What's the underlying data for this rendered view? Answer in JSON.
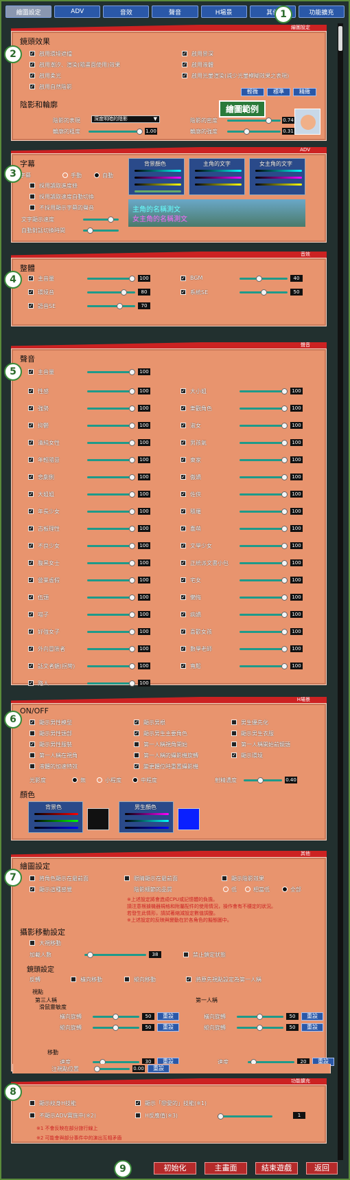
{
  "tabs": [
    "繪圖設定",
    "ADV",
    "音效",
    "聲音",
    "H場景",
    "其他",
    "功能擴充"
  ],
  "sections": {
    "draw": "繪圖設定",
    "adv": "ADV",
    "sound": "音效",
    "voice": "聲音",
    "h": "H場景",
    "other": "其他",
    "ext": "功能擴充"
  },
  "markers": [
    "1",
    "2",
    "3",
    "4",
    "5",
    "6",
    "7",
    "8",
    "9"
  ],
  "lens": {
    "title": "鏡頭效果",
    "items": [
      "啟用環境遮擋",
      "啟用景深",
      "啟用潮汐、渲染(隨畫面使用)效果",
      "啟用柔光",
      "啟用液體",
      "啟用光暈渲染(減少光暈模糊效果之表現)",
      "啟用自然陰影"
    ],
    "buttons": [
      "輕微",
      "標準",
      "精緻"
    ]
  },
  "shadow": {
    "title": "陰影和輪廓",
    "type_label": "陰影的表現",
    "type_value": "深度明暗的陰影",
    "wt_label": "輪廓的粗度",
    "wt_value": "1.00",
    "dense_label": "陰影的密度",
    "dense_value": "0.74",
    "line_label": "輪廓的強度",
    "line_value": "0.31",
    "sample": "繪圖範例"
  },
  "caption": {
    "title": "字幕",
    "mode_label": "字幕",
    "opts": [
      "手動",
      "自動"
    ],
    "items": [
      "採用讀取進度條",
      "採用讀取速度自動切換",
      "不採用顯示字幕的聲音"
    ],
    "speed_label": "文字顯示速度",
    "auto_label": "自動對話切換時間",
    "boxes": [
      "背景顏色",
      "主角的文字",
      "女主角的文字"
    ],
    "sample1": "主角的名稱測文",
    "sample2": "女主角的名稱測文"
  },
  "sfx": {
    "title": "整體",
    "rows": [
      [
        "主音量",
        "100"
      ],
      [
        "BGM",
        "40"
      ],
      [
        "環境音",
        "80"
      ],
      [
        "系統SE",
        "50"
      ],
      [
        "語音SE",
        "70"
      ]
    ]
  },
  "voice": {
    "title": "聲音",
    "master": [
      "主音量",
      "100"
    ],
    "rows": [
      [
        "性感",
        "100"
      ],
      [
        "大小姐",
        "100"
      ],
      [
        "強勢",
        "100"
      ],
      [
        "樂觀角色",
        "100"
      ],
      [
        "抑鬱",
        "100"
      ],
      [
        "淑女",
        "100"
      ],
      [
        "清純女性",
        "100"
      ],
      [
        "男孩氣",
        "100"
      ],
      [
        "年輕隨意",
        "100"
      ],
      [
        "東家",
        "100"
      ],
      [
        "悲劇側",
        "100"
      ],
      [
        "傲嬌",
        "100"
      ],
      [
        "大姐姐",
        "100"
      ],
      [
        "佐俠",
        "100"
      ],
      [
        "年長少女",
        "100"
      ],
      [
        "積羅",
        "100"
      ],
      [
        "古板理性",
        "100"
      ],
      [
        "蠢萌",
        "100"
      ],
      [
        "不良少女",
        "100"
      ],
      [
        "文學少女",
        "100"
      ],
      [
        "腹黑女士",
        "100"
      ],
      [
        "正統派文書小包",
        "100"
      ],
      [
        "營業虛假",
        "100"
      ],
      [
        "宅女",
        "100"
      ],
      [
        "伍頭",
        "100"
      ],
      [
        "懶悔",
        "100"
      ],
      [
        "喵子",
        "100"
      ],
      [
        "病嬌",
        "100"
      ],
      [
        "好強女子",
        "100"
      ],
      [
        "喜歡女孩",
        "100"
      ],
      [
        "外向冒險者",
        "100"
      ],
      [
        "數學老師",
        "100"
      ],
      [
        "話文者靚(拐彎)",
        "100"
      ],
      [
        "寬鬆",
        "100"
      ],
      [
        "路人",
        "100"
      ]
    ]
  },
  "honoff": {
    "title": "ON/OFF",
    "items": [
      "顯示男性模型",
      "顯示男根",
      "男生優先化",
      "顯示男性頭部",
      "顯示男生主要角色",
      "顯示男生衣服",
      "顯示男性服裝",
      "第一人稱視角開始",
      "第一人稱開始前鏡頭",
      "第一人稱在視角",
      "第一人稱的攝影機旋轉",
      "顯示環境",
      "液體的加速特效",
      "變更體位時重置攝影機"
    ],
    "tone_label": "光影度",
    "tone_opts": [
      "無",
      "小程度",
      "中程度"
    ],
    "depth_label": "射精濃度",
    "depth_value": "0.40",
    "color_title": "顏色",
    "bg_label": "背景色",
    "male_label": "男生顏色"
  },
  "other": {
    "title": "繪圖設定",
    "items": [
      "將角色顯示在最前面",
      "眼睛顯示在最前面",
      "顯示陰影效果",
      "顯示這種感覺",
      "陰影細節的品質"
    ],
    "q_opts": [
      "低",
      "相當低",
      "全部"
    ],
    "notes": [
      "※上述設定將會造成CPU或記憶體的負擔。",
      "請注意根據機器規格和附屬配件的使用情況，操作會有不穩定的狀況。",
      "若發生此情形，請試著縮減設定數值調整。",
      "※上述設定的反映與變動在於各角色的擬態圖中。"
    ],
    "move_title": "攝影移動設定",
    "move_items": [
      "大視移動",
      "禁止鎖定狀態"
    ],
    "count_label": "加載人數",
    "count_value": "38",
    "lens_title": "鏡頭設定",
    "invert_label": "反轉",
    "inv_items": [
      "橫向移動",
      "縱向移動",
      "將原先視點設定為第一人稱"
    ],
    "third": "第三人稱",
    "first": "第一人稱",
    "view": "視點",
    "sens": "滑鼠靈敏度",
    "h_rot": "橫向旋轉",
    "v_rot": "縱向旋轉",
    "move": "移動",
    "speed": "速度",
    "zoom": "注視點位置",
    "v50": "50",
    "v30": "30",
    "v20": "20",
    "v000": "0.00",
    "reset": "重設"
  },
  "ext": {
    "items": [
      "顯示紋身H技能",
      "顯示「戀愛的」技能(※1)",
      "不顯示ADV實施中(※2)",
      "H反應值(※3)"
    ],
    "value": "1",
    "notes": [
      "※1  不會反映在部分旅行線上",
      "※2  可能會與部分事件中的演出互相矛盾"
    ]
  },
  "footer": {
    "buttons": [
      "初始化",
      "主畫面",
      "結束遊戲",
      "返回"
    ]
  }
}
